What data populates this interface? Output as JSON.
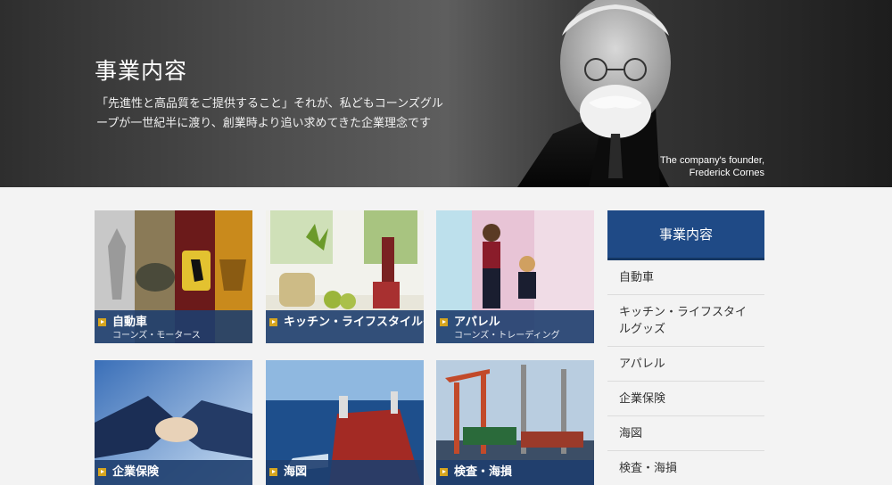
{
  "hero": {
    "title": "事業内容",
    "description": "「先進性と高品質をご提供すること」それが、私どもコーンズグループが一世紀半に渡り、創業時より追い求めてきた企業理念です",
    "caption_line1": "The company's founder,",
    "caption_line2": "Frederick Cornes"
  },
  "cards": [
    {
      "title": "自動車",
      "subtitle": "コーンズ・モータース"
    },
    {
      "title": "キッチン・ライフスタイルグッズ",
      "subtitle": ""
    },
    {
      "title": "アパレル",
      "subtitle": "コーンズ・トレーディング"
    },
    {
      "title": "企業保険",
      "subtitle": ""
    },
    {
      "title": "海図",
      "subtitle": ""
    },
    {
      "title": "検査・海損",
      "subtitle": ""
    }
  ],
  "sidebar": {
    "header": "事業内容",
    "items": [
      {
        "label": "自動車"
      },
      {
        "label": "キッチン・ライフスタイルグッズ"
      },
      {
        "label": "アパレル"
      },
      {
        "label": "企業保険"
      },
      {
        "label": "海図"
      },
      {
        "label": "検査・海損"
      }
    ]
  }
}
